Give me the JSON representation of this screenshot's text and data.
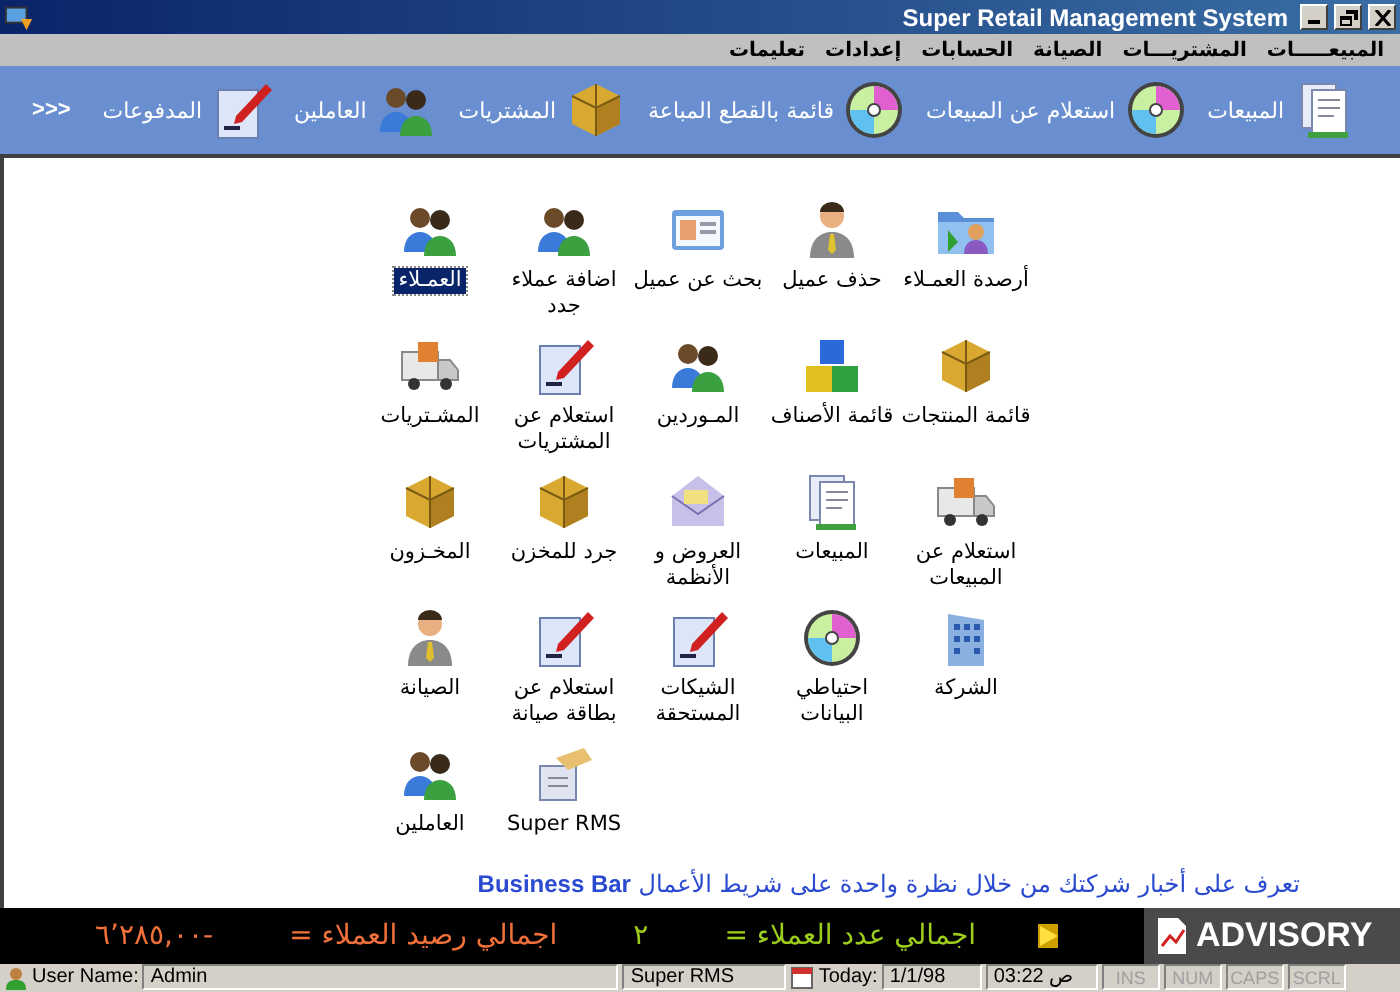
{
  "window": {
    "title": "Super Retail Management System"
  },
  "menu": [
    {
      "label": "المبيعـــــات"
    },
    {
      "label": "المشتريـــات"
    },
    {
      "label": "الصيانة"
    },
    {
      "label": "الحسابات"
    },
    {
      "label": "إعدادات"
    },
    {
      "label": "تعليمات"
    }
  ],
  "toolbar": {
    "items": [
      {
        "label": "المبيعات"
      },
      {
        "label": "استعلام عن المبيعات"
      },
      {
        "label": "قائمة بالقطع المباعة"
      },
      {
        "label": "المشتريات"
      },
      {
        "label": "العاملين"
      },
      {
        "label": "المدفوعات"
      }
    ],
    "more": "<<<"
  },
  "shortcuts": [
    {
      "label": "أرصدة العمـلاء",
      "selected": false
    },
    {
      "label": "حذف عميل",
      "selected": false
    },
    {
      "label": "بحث عن عميل",
      "selected": false
    },
    {
      "label": "اضافة عملاء جدد",
      "selected": false
    },
    {
      "label": "العمـلاء",
      "selected": true
    },
    {
      "label": "قائمة المنتجات",
      "selected": false
    },
    {
      "label": "قائمة الأصناف",
      "selected": false
    },
    {
      "label": "المـوردين",
      "selected": false
    },
    {
      "label": "استعلام عن المشتريات",
      "selected": false
    },
    {
      "label": "المشـتريات",
      "selected": false
    },
    {
      "label": "استعلام عن المبيعات",
      "selected": false
    },
    {
      "label": "المبيعات",
      "selected": false
    },
    {
      "label": "العروض و الأنظمة",
      "selected": false
    },
    {
      "label": "جرد للمخزن",
      "selected": false
    },
    {
      "label": "المخـزون",
      "selected": false
    },
    {
      "label": "الشركة",
      "selected": false
    },
    {
      "label": "احتياطي البيانات",
      "selected": false
    },
    {
      "label": "الشيكات المستحقة",
      "selected": false
    },
    {
      "label": "استعلام عن بطاقة صيانة",
      "selected": false
    },
    {
      "label": "الصيانة",
      "selected": false
    },
    {
      "label": "Super RMS",
      "selected": false
    },
    {
      "label": "العاملين",
      "selected": false
    }
  ],
  "business_bar": "تعرف على أخبار شركتك من خلال نظرة واحدة على شريط الأعمال **Business Bar**",
  "ticker": {
    "logo": "ADVISORY",
    "items": [
      {
        "label": "اجمالي عدد العملاء =",
        "value": "٢",
        "color": "#9ccc1c"
      },
      {
        "label": "اجمالي رصيد العملاء =",
        "value": "٦٬٢٨٥,٠٠-",
        "color": "#f0703a"
      }
    ]
  },
  "status_bar": {
    "user_label": "User Name:",
    "user": "Admin",
    "app": "Super RMS",
    "today_label": "Today:",
    "date": "1/1/98",
    "time": "03:22 ص",
    "indicators": [
      {
        "label": "SCRL",
        "on": false
      },
      {
        "label": "CAPS",
        "on": false
      },
      {
        "label": "NUM",
        "on": false
      },
      {
        "label": "INS",
        "on": false
      }
    ]
  }
}
